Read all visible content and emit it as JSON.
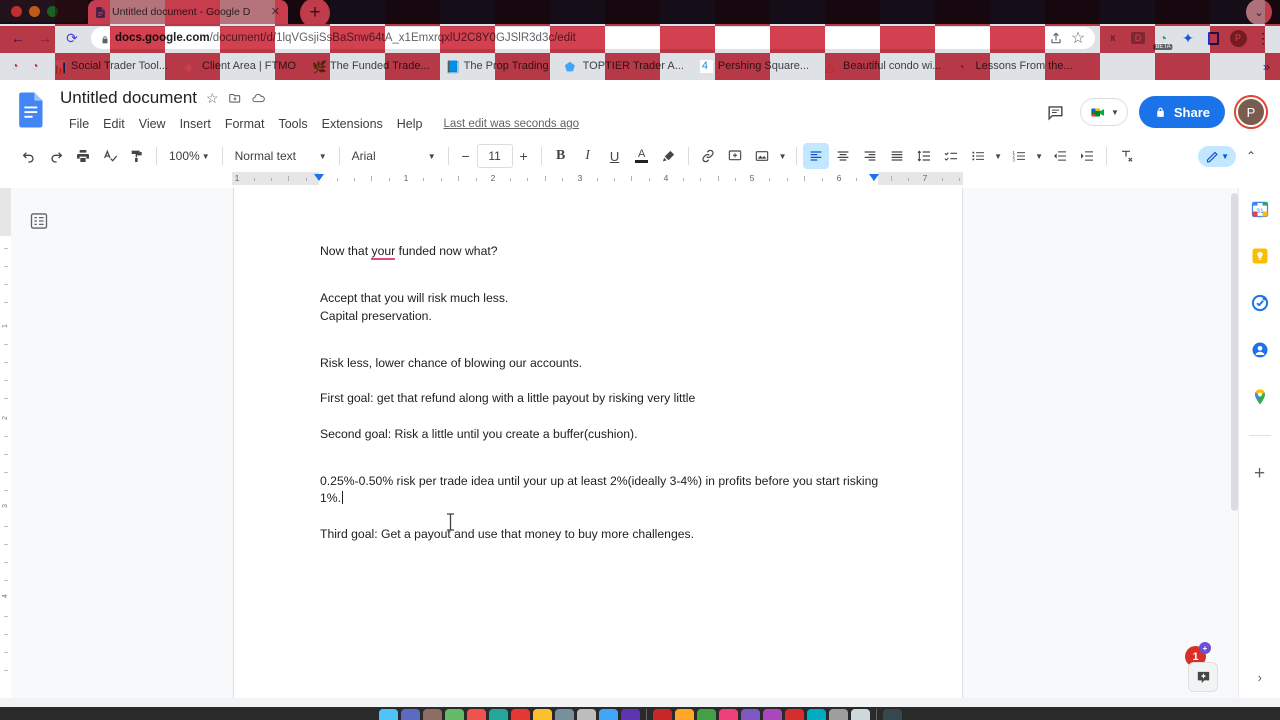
{
  "browser": {
    "tab": {
      "title": "Untitled document - Google D",
      "favicon": "google-docs-icon",
      "close": "✕"
    },
    "newtab_label": "+",
    "window_control": "⌄",
    "nav": {
      "back": "←",
      "forward": "→",
      "reload": "⟳"
    },
    "omnibox": {
      "lock": "lock-icon",
      "url_domain": "docs.google.com",
      "url_path": "/document/d/1lqVGsjiSsBaSnw64tA_x1EmxrqxlU2C8Y0GJSlR3d3c/edit",
      "share_icon": "share-icon",
      "bookmark_star": "☆"
    },
    "extensions": [
      {
        "name": "extension-puzzle-k",
        "glyph": "ĸ",
        "color": "#5f6368"
      },
      {
        "name": "extension-d",
        "glyph": "D",
        "color": "#5f6368"
      },
      {
        "name": "extension-beta",
        "glyph": "◔",
        "color": "#34a853",
        "tag": "BETA"
      },
      {
        "name": "extension-puzzle",
        "glyph": "✦",
        "color": "#1a56db"
      },
      {
        "name": "extension-square",
        "glyph": "□",
        "color": "#2b2bd6"
      }
    ],
    "profile_initial": "P",
    "menu_dots": "⋮",
    "bookmarks": [
      {
        "label": "Social Trader Tool...",
        "favicon": "chart-icon",
        "color": "#29b6f6"
      },
      {
        "label": "Client Area | FTMO",
        "favicon": "diamond-icon",
        "color": "#ffffff"
      },
      {
        "label": "The Funded Trade...",
        "favicon": "leaf-icon",
        "color": "#ffd54f"
      },
      {
        "label": "The Prop Trading",
        "favicon": "book-icon",
        "color": "#5c6bc0"
      },
      {
        "label": "TOPTIER Trader A...",
        "favicon": "tier-icon",
        "color": "#42a5f5"
      },
      {
        "label": "Pershing Square...",
        "favicon": "four-icon",
        "color": "#1e88e5"
      },
      {
        "label": "Beautiful condo wi...",
        "favicon": "airbnb-icon",
        "color": "#ff5a5f"
      },
      {
        "label": "Lessons From the...",
        "favicon": "swirl-icon",
        "color": "#c62828"
      }
    ],
    "bookmark_overflow": "»",
    "reading_list_icons": [
      "swirl-icon-a",
      "swirl-icon-b"
    ]
  },
  "docs": {
    "logo": "google-docs-logo",
    "title": "Untitled document",
    "title_actions": [
      {
        "name": "star-icon",
        "glyph": "☆"
      },
      {
        "name": "move-to-folder-icon",
        "glyph": "❐"
      },
      {
        "name": "cloud-saved-icon",
        "glyph": "☁"
      }
    ],
    "menus": [
      "File",
      "Edit",
      "View",
      "Insert",
      "Format",
      "Tools",
      "Extensions",
      "Help"
    ],
    "last_edit": "Last edit was seconds ago",
    "comment_history_icon": "comment-icon",
    "meet_label": "meet-icon",
    "share_label": "Share",
    "share_lock_icon": "🔒",
    "avatar_initial": "P",
    "toolbar": {
      "undo": "↶",
      "redo": "↷",
      "print": "print-icon",
      "spellcheck": "spellcheck-icon",
      "paint_format": "paint-format-icon",
      "zoom_value": "100%",
      "style_value": "Normal text",
      "font_value": "Arial",
      "font_size": "11",
      "font_size_minus": "−",
      "font_size_plus": "+",
      "bold": "B",
      "italic": "I",
      "underline": "U",
      "text_color": "A",
      "highlight": "highlight-pen-icon",
      "link": "link-icon",
      "comment": "add-comment-icon",
      "image": "insert-image-icon",
      "align_left": "align-left-icon",
      "align_center": "align-center-icon",
      "align_right": "align-right-icon",
      "align_justify": "align-justify-icon",
      "line_spacing": "line-spacing-icon",
      "checklist": "checklist-icon",
      "bulleted_list": "bulleted-list-icon",
      "numbered_list": "numbered-list-icon",
      "decrease_indent": "decrease-indent-icon",
      "increase_indent": "increase-indent-icon",
      "clear_formatting": "clear-formatting-icon",
      "editing_mode": "pencil-icon",
      "hide_menus": "⌃"
    },
    "ruler": {
      "numbers": [
        "1",
        "1",
        "2",
        "3",
        "4",
        "5",
        "6",
        "7"
      ],
      "left_indent_in": 0.5,
      "right_indent_in": 6.5
    },
    "vruler_numbers": [
      "1",
      "2",
      "3",
      "4"
    ],
    "outline_icon": "document-outline-icon",
    "document": {
      "paragraphs": [
        {
          "id": "p1",
          "text": "Now that your funded now what?",
          "misspelled": "your"
        },
        {
          "id": "p2",
          "text": "Accept that you will risk much less."
        },
        {
          "id": "p3",
          "text": "Capital preservation."
        },
        {
          "id": "p4",
          "text": "Risk less, lower chance of blowing our accounts."
        },
        {
          "id": "p5",
          "text": "First goal: get that refund along with a little payout by risking very little"
        },
        {
          "id": "p6",
          "text": "Second goal: Risk a little until you create a buffer(cushion)."
        },
        {
          "id": "p7",
          "text": "0.25%-0.50% risk per trade idea until your up at least 2%(ideally 3-4%)  in profits before you start risking 1%."
        },
        {
          "id": "p8",
          "text": "Third goal: Get a payout and use that money to buy more challenges."
        }
      ]
    },
    "side_panel": [
      {
        "name": "google-calendar-icon",
        "label": "31"
      },
      {
        "name": "google-keep-icon",
        "label": ""
      },
      {
        "name": "google-tasks-icon",
        "label": ""
      },
      {
        "name": "google-contacts-icon",
        "label": ""
      },
      {
        "name": "google-maps-icon",
        "label": ""
      },
      {
        "name": "get-addons-icon",
        "label": "+"
      }
    ],
    "explore_button": "explore-sparkle-icon",
    "notification_badge": "1",
    "notification_badge_plus": "+",
    "panel_expand": "›"
  },
  "dock": {
    "icons": [
      "#4fc3f7",
      "#5c6bc0",
      "#8d6e63",
      "#66bb6a",
      "#ef5350",
      "#26a69a",
      "#e53935",
      "#fbc02d",
      "#78909c",
      "#bdbdbd",
      "#42a5f5",
      "#5e35b1",
      "#c62828",
      "#ffa726",
      "#43a047",
      "#ec407a",
      "#7e57c2",
      "#ab47bc",
      "#d32f2f",
      "#00acc1",
      "#9e9e9e",
      "#cfd8dc",
      "#263238",
      "#37474f"
    ],
    "trash": "trash-icon"
  }
}
